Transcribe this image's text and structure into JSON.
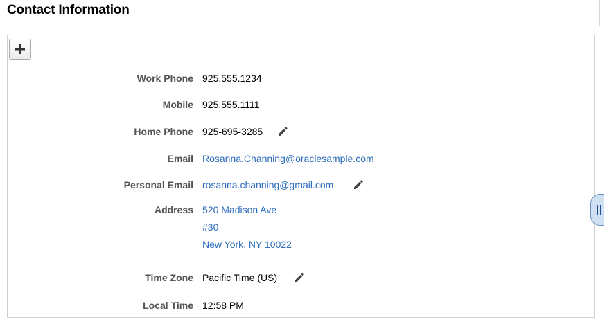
{
  "section": {
    "title": "Contact Information"
  },
  "toolbar": {
    "add_icon": "plus-icon"
  },
  "fields": {
    "work_phone": {
      "label": "Work Phone",
      "value": "925.555.1234"
    },
    "mobile": {
      "label": "Mobile",
      "value": "925.555.1111"
    },
    "home_phone": {
      "label": "Home Phone",
      "value": "925-695-3285",
      "edit_icon": "pencil-icon"
    },
    "email": {
      "label": "Email",
      "value": "Rosanna.Channing@oraclesample.com"
    },
    "personal_email": {
      "label": "Personal Email",
      "value": "rosanna.channing@gmail.com",
      "edit_icon": "pencil-icon"
    },
    "address": {
      "label": "Address",
      "line1": "520 Madison Ave",
      "line2": "#30",
      "line3": "New York, NY 10022"
    },
    "time_zone": {
      "label": "Time Zone",
      "value": "Pacific Time (US)",
      "edit_icon": "pencil-icon"
    },
    "local_time": {
      "label": "Local Time",
      "value": "12:58 PM"
    }
  },
  "side_panel": {
    "handle_icon": "drag-handle-icon"
  },
  "colors": {
    "link": "#2d6dbc",
    "label": "#545454",
    "border": "#d0d0d0",
    "handle_fill": "#cfe0f3",
    "handle_border": "#6b8fbf"
  }
}
